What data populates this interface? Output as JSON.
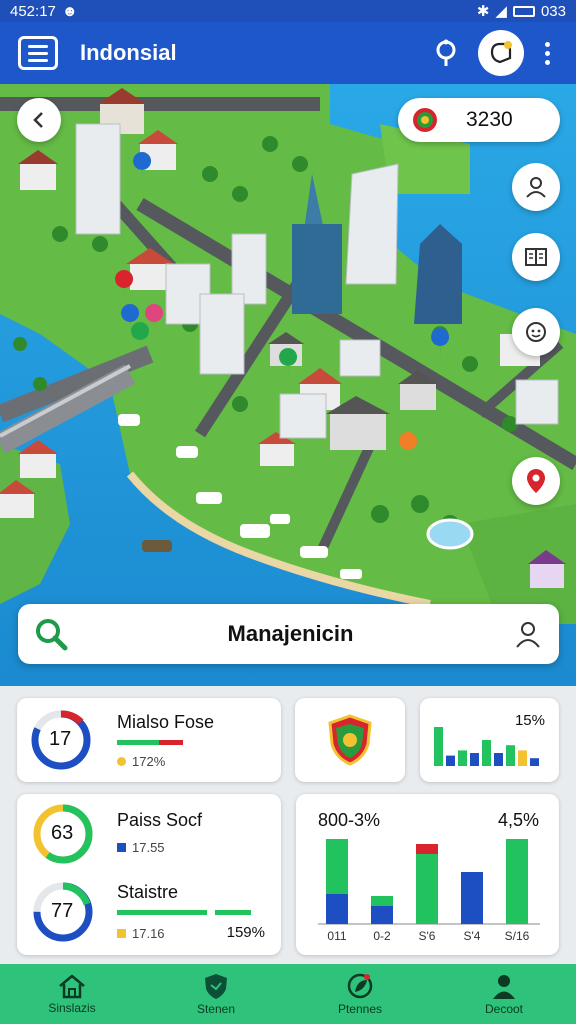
{
  "status_bar": {
    "time": "452:17",
    "right_text": "033"
  },
  "app_bar": {
    "title": "Indonsial"
  },
  "map": {
    "score_value": "3230"
  },
  "search": {
    "label": "Manajenicin"
  },
  "cards": {
    "card1": {
      "ring_value": "17",
      "title": "Mialso Fose",
      "sub": "172%",
      "ring_fraction": 0.82
    },
    "card3": {
      "percent": "15%",
      "bars": [
        0.75,
        0.2,
        0.3,
        0.25,
        0.5,
        0.25,
        0.4,
        0.3,
        0.15
      ]
    },
    "card4": {
      "ring_value": "63",
      "title": "Paiss Socf",
      "sub": "17.55",
      "ring_fraction": 0.6
    },
    "card5": {
      "ring_value": "77",
      "title": "Staistre",
      "sub": "17.16",
      "percent": "159%",
      "ring_fraction": 0.75
    },
    "card6": {
      "left_label": "800-3%",
      "right_label": "4,5%",
      "tick_labels": [
        "011",
        "0-2",
        "S'6",
        "S'4",
        "S/16"
      ]
    }
  },
  "chart_data": {
    "type": "bar",
    "categories": [
      "011",
      "0-2",
      "S'6",
      "S'4",
      "S/16"
    ],
    "series": [
      {
        "values": [
          55,
          10,
          0,
          0,
          0
        ]
      },
      {
        "values": [
          30,
          18,
          70,
          0,
          85
        ]
      },
      {
        "values": [
          0,
          0,
          10,
          0,
          0
        ]
      },
      {
        "values": [
          0,
          0,
          0,
          52,
          0
        ]
      }
    ]
  },
  "bottom_nav": [
    {
      "label": "Sinslazis",
      "icon": "home-icon"
    },
    {
      "label": "Stenen",
      "icon": "shield-icon"
    },
    {
      "label": "Ptennes",
      "icon": "leaf-icon"
    },
    {
      "label": "Decoot",
      "icon": "person-icon"
    }
  ],
  "colors": {
    "primary": "#1e57c9",
    "accent_green": "#2ec27a",
    "bar_blue": "#1e4fc2",
    "bar_green": "#22c35e",
    "bar_red": "#d8242c"
  }
}
